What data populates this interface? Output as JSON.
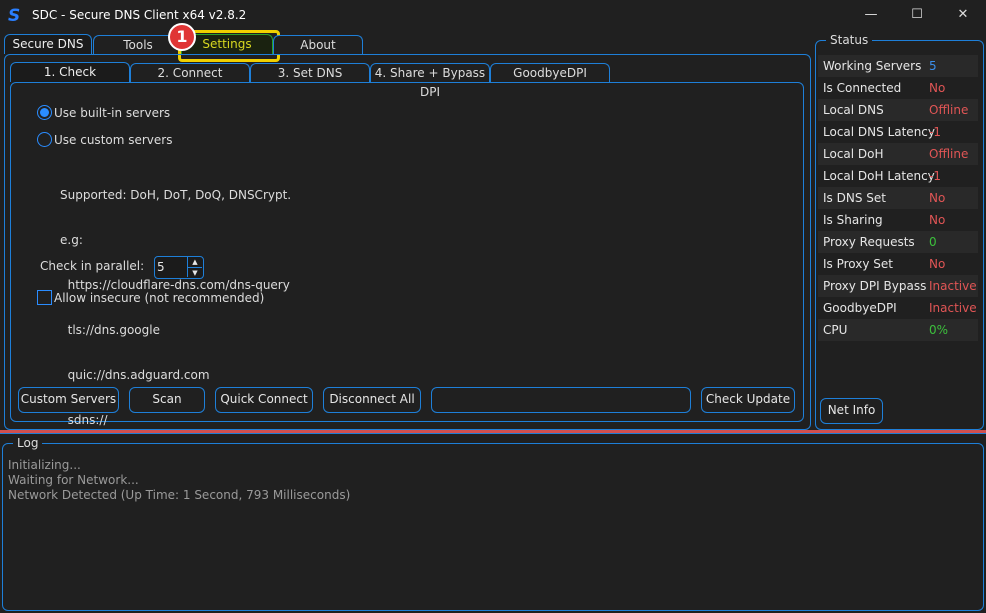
{
  "window": {
    "title": "SDC - Secure DNS Client x64 v2.8.2",
    "logo": "S",
    "minimize": "—",
    "maximize": "☐",
    "close": "✕"
  },
  "tabs": [
    {
      "label": "Secure DNS"
    },
    {
      "label": "Tools"
    },
    {
      "label": "Settings"
    },
    {
      "label": "About"
    }
  ],
  "annotation": {
    "badge": "1"
  },
  "subtabs": [
    {
      "label": "1. Check"
    },
    {
      "label": "2. Connect"
    },
    {
      "label": "3. Set DNS"
    },
    {
      "label": "4. Share + Bypass DPI"
    },
    {
      "label": "GoodbyeDPI"
    }
  ],
  "check": {
    "radio_builtin": "Use built-in servers",
    "radio_custom": "Use custom servers",
    "help": [
      "Supported: DoH, DoT, DoQ, DNSCrypt.",
      "e.g:",
      "  https://cloudflare-dns.com/dns-query",
      "  tls://dns.google",
      "  quic://dns.adguard.com",
      "  sdns://"
    ],
    "parallel_label": "Check in parallel:",
    "parallel_value": "5",
    "insecure_label": "Allow insecure (not recommended)",
    "selected": "builtin",
    "insecure_checked": false
  },
  "buttons": {
    "custom_servers": "Custom Servers",
    "scan": "Scan",
    "quick_connect": "Quick Connect",
    "disconnect_all": "Disconnect All",
    "status_field": "",
    "check_update": "Check Update",
    "net_info": "Net Info"
  },
  "status": {
    "title": "Status",
    "rows": [
      {
        "label": "Working Servers",
        "value": "5",
        "color": "#3b8eea"
      },
      {
        "label": "Is Connected",
        "value": "No",
        "color": "#e05555"
      },
      {
        "label": "Local DNS",
        "value": "Offline",
        "color": "#e05555"
      },
      {
        "label": "Local DNS Latency",
        "value": "-1",
        "color": "#e05555"
      },
      {
        "label": "Local DoH",
        "value": "Offline",
        "color": "#e05555"
      },
      {
        "label": "Local DoH Latency",
        "value": "-1",
        "color": "#e05555"
      },
      {
        "label": "Is DNS Set",
        "value": "No",
        "color": "#e05555"
      },
      {
        "label": "Is Sharing",
        "value": "No",
        "color": "#e05555"
      },
      {
        "label": "Proxy Requests",
        "value": "0",
        "color": "#3cc03c"
      },
      {
        "label": "Is Proxy Set",
        "value": "No",
        "color": "#e05555"
      },
      {
        "label": "Proxy DPI Bypass",
        "value": "Inactive",
        "color": "#e05555"
      },
      {
        "label": "GoodbyeDPI",
        "value": "Inactive",
        "color": "#e05555"
      },
      {
        "label": "CPU",
        "value": "0%",
        "color": "#3cc03c"
      }
    ]
  },
  "log": {
    "title": "Log",
    "lines": [
      "Initializing...",
      "Waiting for Network...",
      "Network Detected (Up Time: 1 Second, 793 Milliseconds)"
    ]
  }
}
